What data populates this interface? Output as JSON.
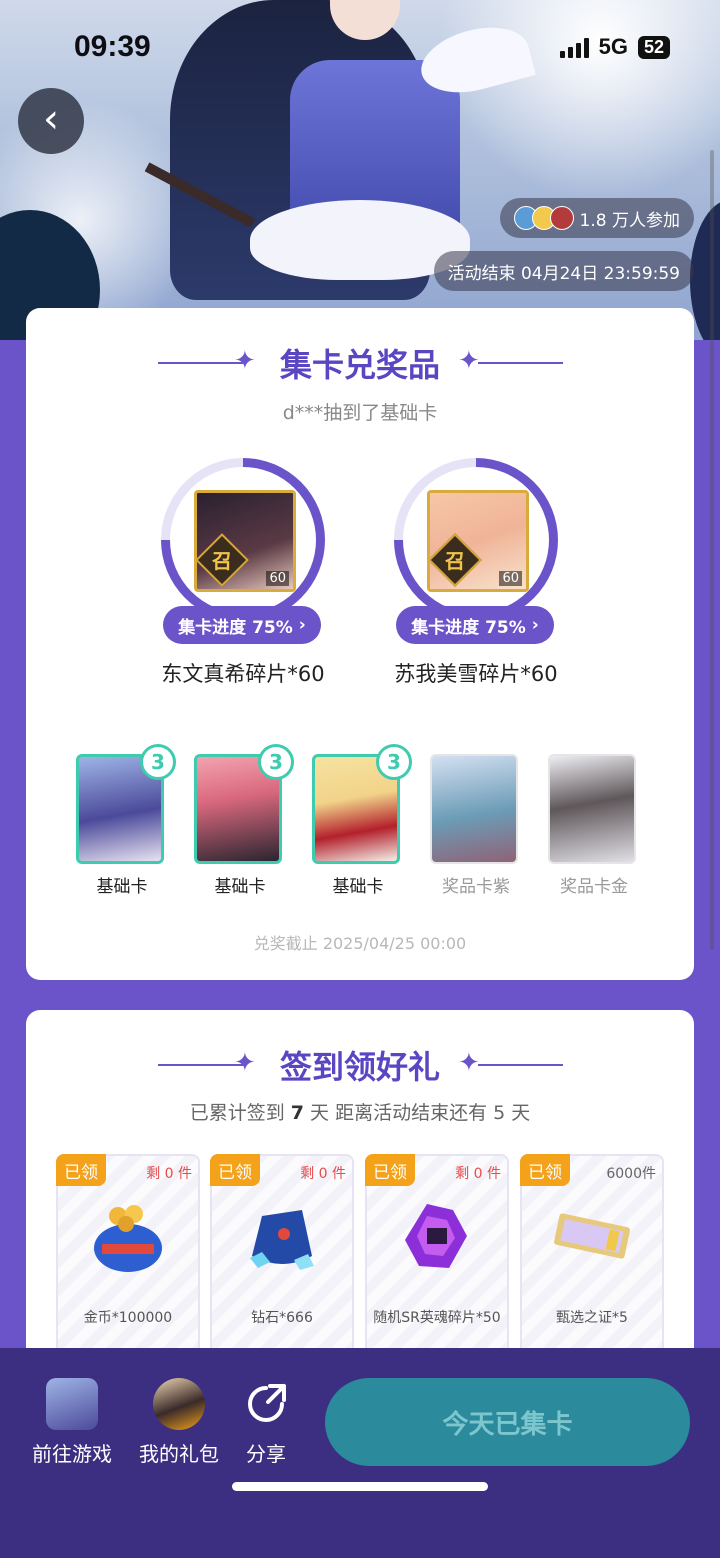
{
  "status": {
    "time": "09:39",
    "network": "5G",
    "battery": "52"
  },
  "hero": {
    "participants": "1.8 万人参加",
    "end_time": "活动结束 04月24日 23:59:59"
  },
  "collect": {
    "title": "集卡兑奖品",
    "ticker": "d***抽到了基础卡",
    "rewards": [
      {
        "name": "东文真希碎片*60",
        "progress_label": "集卡进度 75%",
        "progress": 0.75,
        "badge": "召",
        "count": "60"
      },
      {
        "name": "苏我美雪碎片*60",
        "progress_label": "集卡进度 75%",
        "progress": 0.75,
        "badge": "召",
        "count": "60"
      }
    ],
    "cards": [
      {
        "label": "基础卡",
        "count": "3"
      },
      {
        "label": "基础卡",
        "count": "3"
      },
      {
        "label": "基础卡",
        "count": "3"
      },
      {
        "label": "奖品卡紫"
      },
      {
        "label": "奖品卡金"
      }
    ],
    "deadline": "兑奖截止 2025/04/25 00:00"
  },
  "signin": {
    "title": "签到领好礼",
    "summary_prefix": "已累计签到",
    "days": "7",
    "summary_mid": "天  距离活动结束还有",
    "remain": "5",
    "summary_suffix": "天",
    "gifts": [
      {
        "tag": "已领",
        "stock": "剩 0 件",
        "name": "金币*100000"
      },
      {
        "tag": "已领",
        "stock": "剩 0 件",
        "name": "钻石*666"
      },
      {
        "tag": "已领",
        "stock": "剩 0 件",
        "name": "随机SR英魂碎片*50"
      },
      {
        "tag": "已领",
        "stock": "6000件",
        "name": "甄选之证*5"
      }
    ]
  },
  "bottom": {
    "nav": [
      {
        "label": "前往游戏",
        "icon": "game-avatar-icon"
      },
      {
        "label": "我的礼包",
        "icon": "gift-avatar-icon"
      },
      {
        "label": "分享",
        "icon": "share-icon"
      }
    ],
    "cta": "今天已集卡"
  },
  "colors": {
    "accent": "#6b53c9",
    "teal": "#3fcbae",
    "orange": "#f3a21a"
  }
}
